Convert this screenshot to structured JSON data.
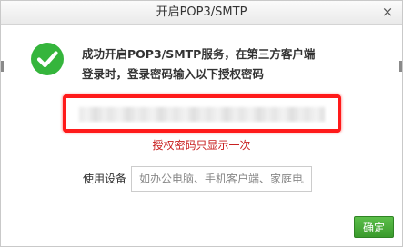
{
  "dialog": {
    "title": "开启POP3/SMTP",
    "close_symbol": "×",
    "message_line1": "成功开启POP3/SMTP服务，在第三方客户端",
    "message_line2": "登录时，登录密码输入以下授权密码",
    "hint": "授权密码只显示一次",
    "device_label": "使用设备",
    "device_placeholder": "如办公电脑、手机客户端、家庭电脑",
    "confirm_label": "确定"
  },
  "icons": {
    "success": "check-circle-icon",
    "close": "close-icon"
  },
  "colors": {
    "success_green": "#35b53c",
    "highlight_red": "#ff1a1a",
    "hint_red": "#c81e1e",
    "button_green": "#3a9a2c"
  }
}
